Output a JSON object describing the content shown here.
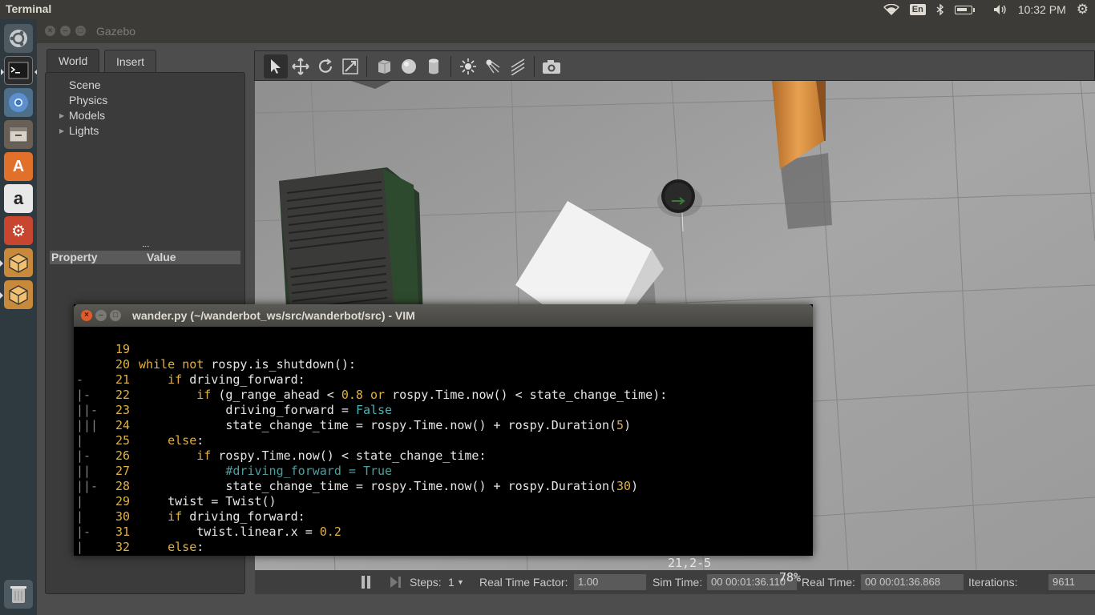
{
  "topbar": {
    "app_title": "Terminal",
    "lang": "En",
    "clock": "10:32 PM"
  },
  "launcher": {
    "items": [
      {
        "name": "ubuntu-dash-icon"
      },
      {
        "name": "terminal-icon"
      },
      {
        "name": "chromium-icon"
      },
      {
        "name": "files-icon"
      },
      {
        "name": "software-center-icon"
      },
      {
        "name": "amazon-icon"
      },
      {
        "name": "system-settings-icon"
      },
      {
        "name": "gazebo-icon"
      },
      {
        "name": "gazebo-icon-2"
      }
    ]
  },
  "gazebo": {
    "title": "Gazebo",
    "tabs": [
      {
        "label": "World"
      },
      {
        "label": "Insert"
      }
    ],
    "tree": [
      {
        "label": "Scene",
        "expandable": false
      },
      {
        "label": "Physics",
        "expandable": false
      },
      {
        "label": "Models",
        "expandable": true
      },
      {
        "label": "Lights",
        "expandable": true
      }
    ],
    "property_header": {
      "property": "Property",
      "value": "Value"
    },
    "status": {
      "steps_label": "Steps:",
      "steps_value": "1",
      "rtf_label": "Real Time Factor:",
      "rtf_value": "1.00",
      "sim_time_label": "Sim Time:",
      "sim_time_value": "00 00:01:36.110",
      "real_time_label": "Real Time:",
      "real_time_value": "00 00:01:36.868",
      "iterations_label": "Iterations:",
      "iterations_value": "9611"
    }
  },
  "vim": {
    "title": "wander.py (~/wanderbot_ws/src/wanderbot/src) - VIM",
    "ruler": "21,2-5",
    "percent": "78%",
    "lines": [
      {
        "fold": "",
        "num": "19",
        "code": ""
      },
      {
        "fold": "",
        "num": "20",
        "code": "while not rospy.is_shutdown():"
      },
      {
        "fold": "-",
        "num": "21",
        "code": "    if driving_forward:"
      },
      {
        "fold": "|-",
        "num": "22",
        "code": "        if (g_range_ahead < 0.8 or rospy.Time.now() < state_change_time):"
      },
      {
        "fold": "||-",
        "num": "23",
        "code": "            driving_forward = False"
      },
      {
        "fold": "|||",
        "num": "24",
        "code": "            state_change_time = rospy.Time.now() + rospy.Duration(5)"
      },
      {
        "fold": "|",
        "num": "25",
        "code": "    else:"
      },
      {
        "fold": "|-",
        "num": "26",
        "code": "        if rospy.Time.now() < state_change_time:"
      },
      {
        "fold": "||",
        "num": "27",
        "code": "            #driving_forward = True"
      },
      {
        "fold": "||-",
        "num": "28",
        "code": "            state_change_time = rospy.Time.now() + rospy.Duration(30)"
      },
      {
        "fold": "|",
        "num": "29",
        "code": "    twist = Twist()"
      },
      {
        "fold": "|",
        "num": "30",
        "code": "    if driving_forward:"
      },
      {
        "fold": "|-",
        "num": "31",
        "code": "        twist.linear.x = 0.2"
      },
      {
        "fold": "|",
        "num": "32",
        "code": "    else:"
      }
    ]
  }
}
